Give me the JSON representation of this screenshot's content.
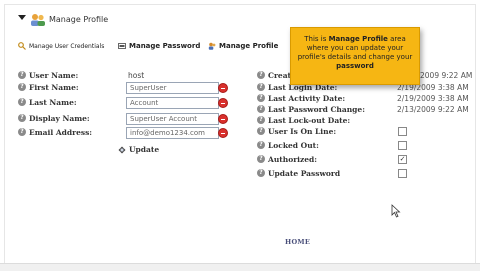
{
  "header": {
    "title": "Manage Profile"
  },
  "links": [
    {
      "label": "Manage User Credentials",
      "icon": "key-icon"
    },
    {
      "label": "Manage Password",
      "icon": "password-icon"
    },
    {
      "label": "Manage Profile",
      "icon": "profile-icon"
    }
  ],
  "form": {
    "user_name": {
      "label": "User Name:",
      "value": "host"
    },
    "first_name": {
      "label": "First Name:",
      "value": "SuperUser"
    },
    "last_name": {
      "label": "Last Name:",
      "value": "Account"
    },
    "display_name": {
      "label": "Display Name:",
      "value": "SuperUser Account"
    },
    "email": {
      "label": "Email Address:",
      "value": "info@demo1234.com"
    },
    "update_label": "Update"
  },
  "right": {
    "created": {
      "label": "Creat",
      "value": "2009 9:22 AM"
    },
    "last_login": {
      "label": "Last Login Date:",
      "value": "2/19/2009 3:38 AM"
    },
    "last_activity": {
      "label": "Last Activity Date:",
      "value": "2/19/2009 3:38 AM"
    },
    "last_password_change": {
      "label": "Last Password Change:",
      "value": "2/13/2009 9:22 AM"
    },
    "last_lockout": {
      "label": "Last Lock-out Date:"
    },
    "online": {
      "label": "User Is On Line:",
      "checked": false
    },
    "locked": {
      "label": "Locked Out:",
      "checked": false
    },
    "authorized": {
      "label": "Authorized:",
      "checked": true
    },
    "update_password": {
      "label": "Update Password",
      "checked": false
    }
  },
  "tooltip": {
    "t1": "This is ",
    "b1": "Manage Profile",
    "t2": " area where you can update your profile's details and change your ",
    "b2": "password"
  },
  "footer": {
    "home": "HOME"
  },
  "colors": {
    "tooltip_bg": "#f6b613",
    "delete_red": "#d9302c"
  }
}
